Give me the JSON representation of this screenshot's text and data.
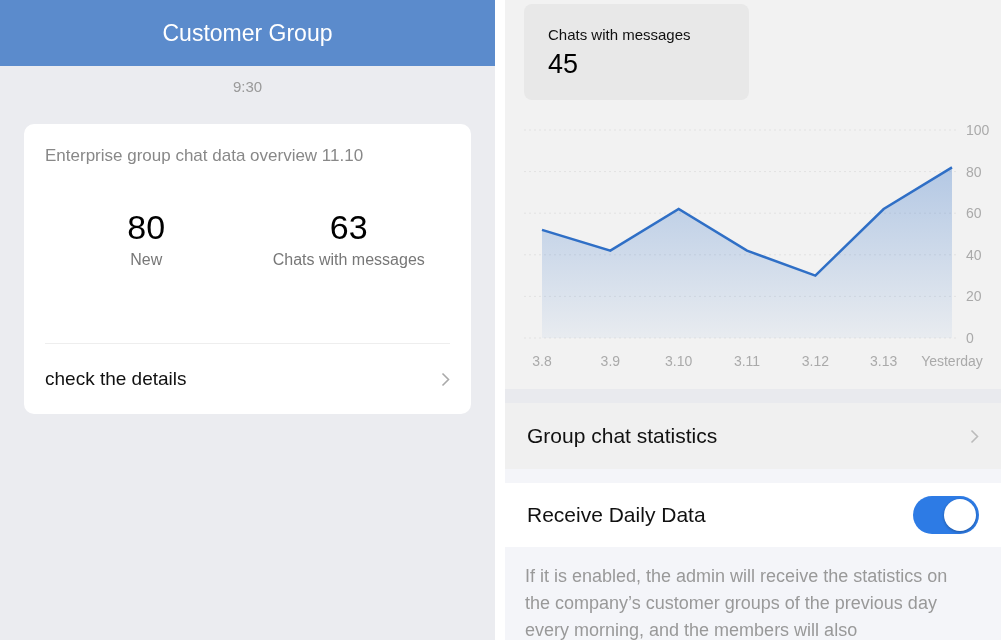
{
  "left_screen": {
    "title": "Customer Group",
    "time": "9:30",
    "overview_card": {
      "title": "Enterprise group chat data overview 11.10",
      "stats": [
        {
          "value": "80",
          "label": "New"
        },
        {
          "value": "63",
          "label": "Chats with messages"
        }
      ],
      "link": "check the details"
    }
  },
  "right_screen": {
    "summary_card": {
      "label": "Chats with messages",
      "value": "45"
    },
    "chart_data": {
      "type": "area",
      "categories": [
        "3.8",
        "3.9",
        "3.10",
        "3.11",
        "3.12",
        "3.13",
        "Yesterday"
      ],
      "series": [
        {
          "color": "#2f6fc6",
          "values": [
            52,
            42,
            62,
            42,
            30,
            62,
            82
          ]
        }
      ],
      "ylim": [
        0,
        100
      ],
      "yticks": [
        0,
        20,
        40,
        60,
        80,
        100
      ],
      "grid": true
    },
    "stats_row": {
      "label": "Group chat statistics"
    },
    "daily_data": {
      "label": "Receive Daily Data",
      "on": true
    },
    "description": "If it is enabled, the admin will receive the statistics on the company’s customer groups of the previous day every morning, and the members will also"
  }
}
